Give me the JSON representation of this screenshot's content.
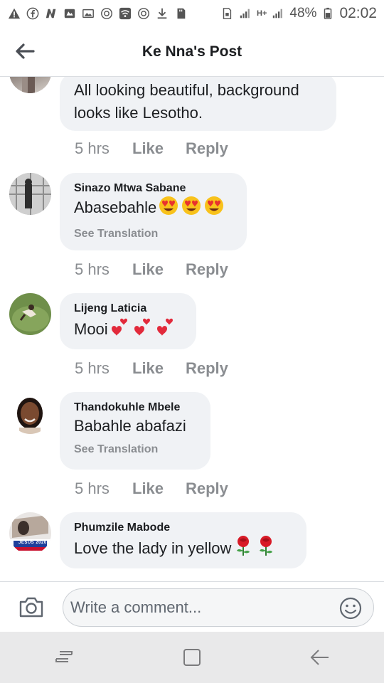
{
  "status_bar": {
    "battery": "48%",
    "time": "02:02",
    "network": "H+"
  },
  "header": {
    "title": "Ke Nna's Post"
  },
  "comments": [
    {
      "author": "",
      "text": "All looking beautiful, background looks like Lesotho.",
      "time": "5 hrs",
      "like": "Like",
      "reply": "Reply"
    },
    {
      "author": "Sinazo Mtwa Sabane",
      "text": "Abasebahle",
      "emoji": "heart-eyes-icon x3",
      "see_translation": "See Translation",
      "time": "5 hrs",
      "like": "Like",
      "reply": "Reply"
    },
    {
      "author": "Lijeng Laticia",
      "text": "Mooi",
      "emoji": "two-hearts-icon x3",
      "time": "5 hrs",
      "like": "Like",
      "reply": "Reply"
    },
    {
      "author": "Thandokuhle Mbele",
      "text": "Babahle abafazi",
      "see_translation": "See Translation",
      "time": "5 hrs",
      "like": "Like",
      "reply": "Reply"
    },
    {
      "author": "Phumzile Mabode",
      "text": "Love the lady in yellow",
      "emoji": "rose-icon x2",
      "avatar_badge": "JESUS 2020"
    }
  ],
  "composer": {
    "placeholder": "Write a comment..."
  },
  "colors": {
    "bubble": "#f0f2f5",
    "muted": "#8a8d91",
    "text": "#1c1e21"
  }
}
